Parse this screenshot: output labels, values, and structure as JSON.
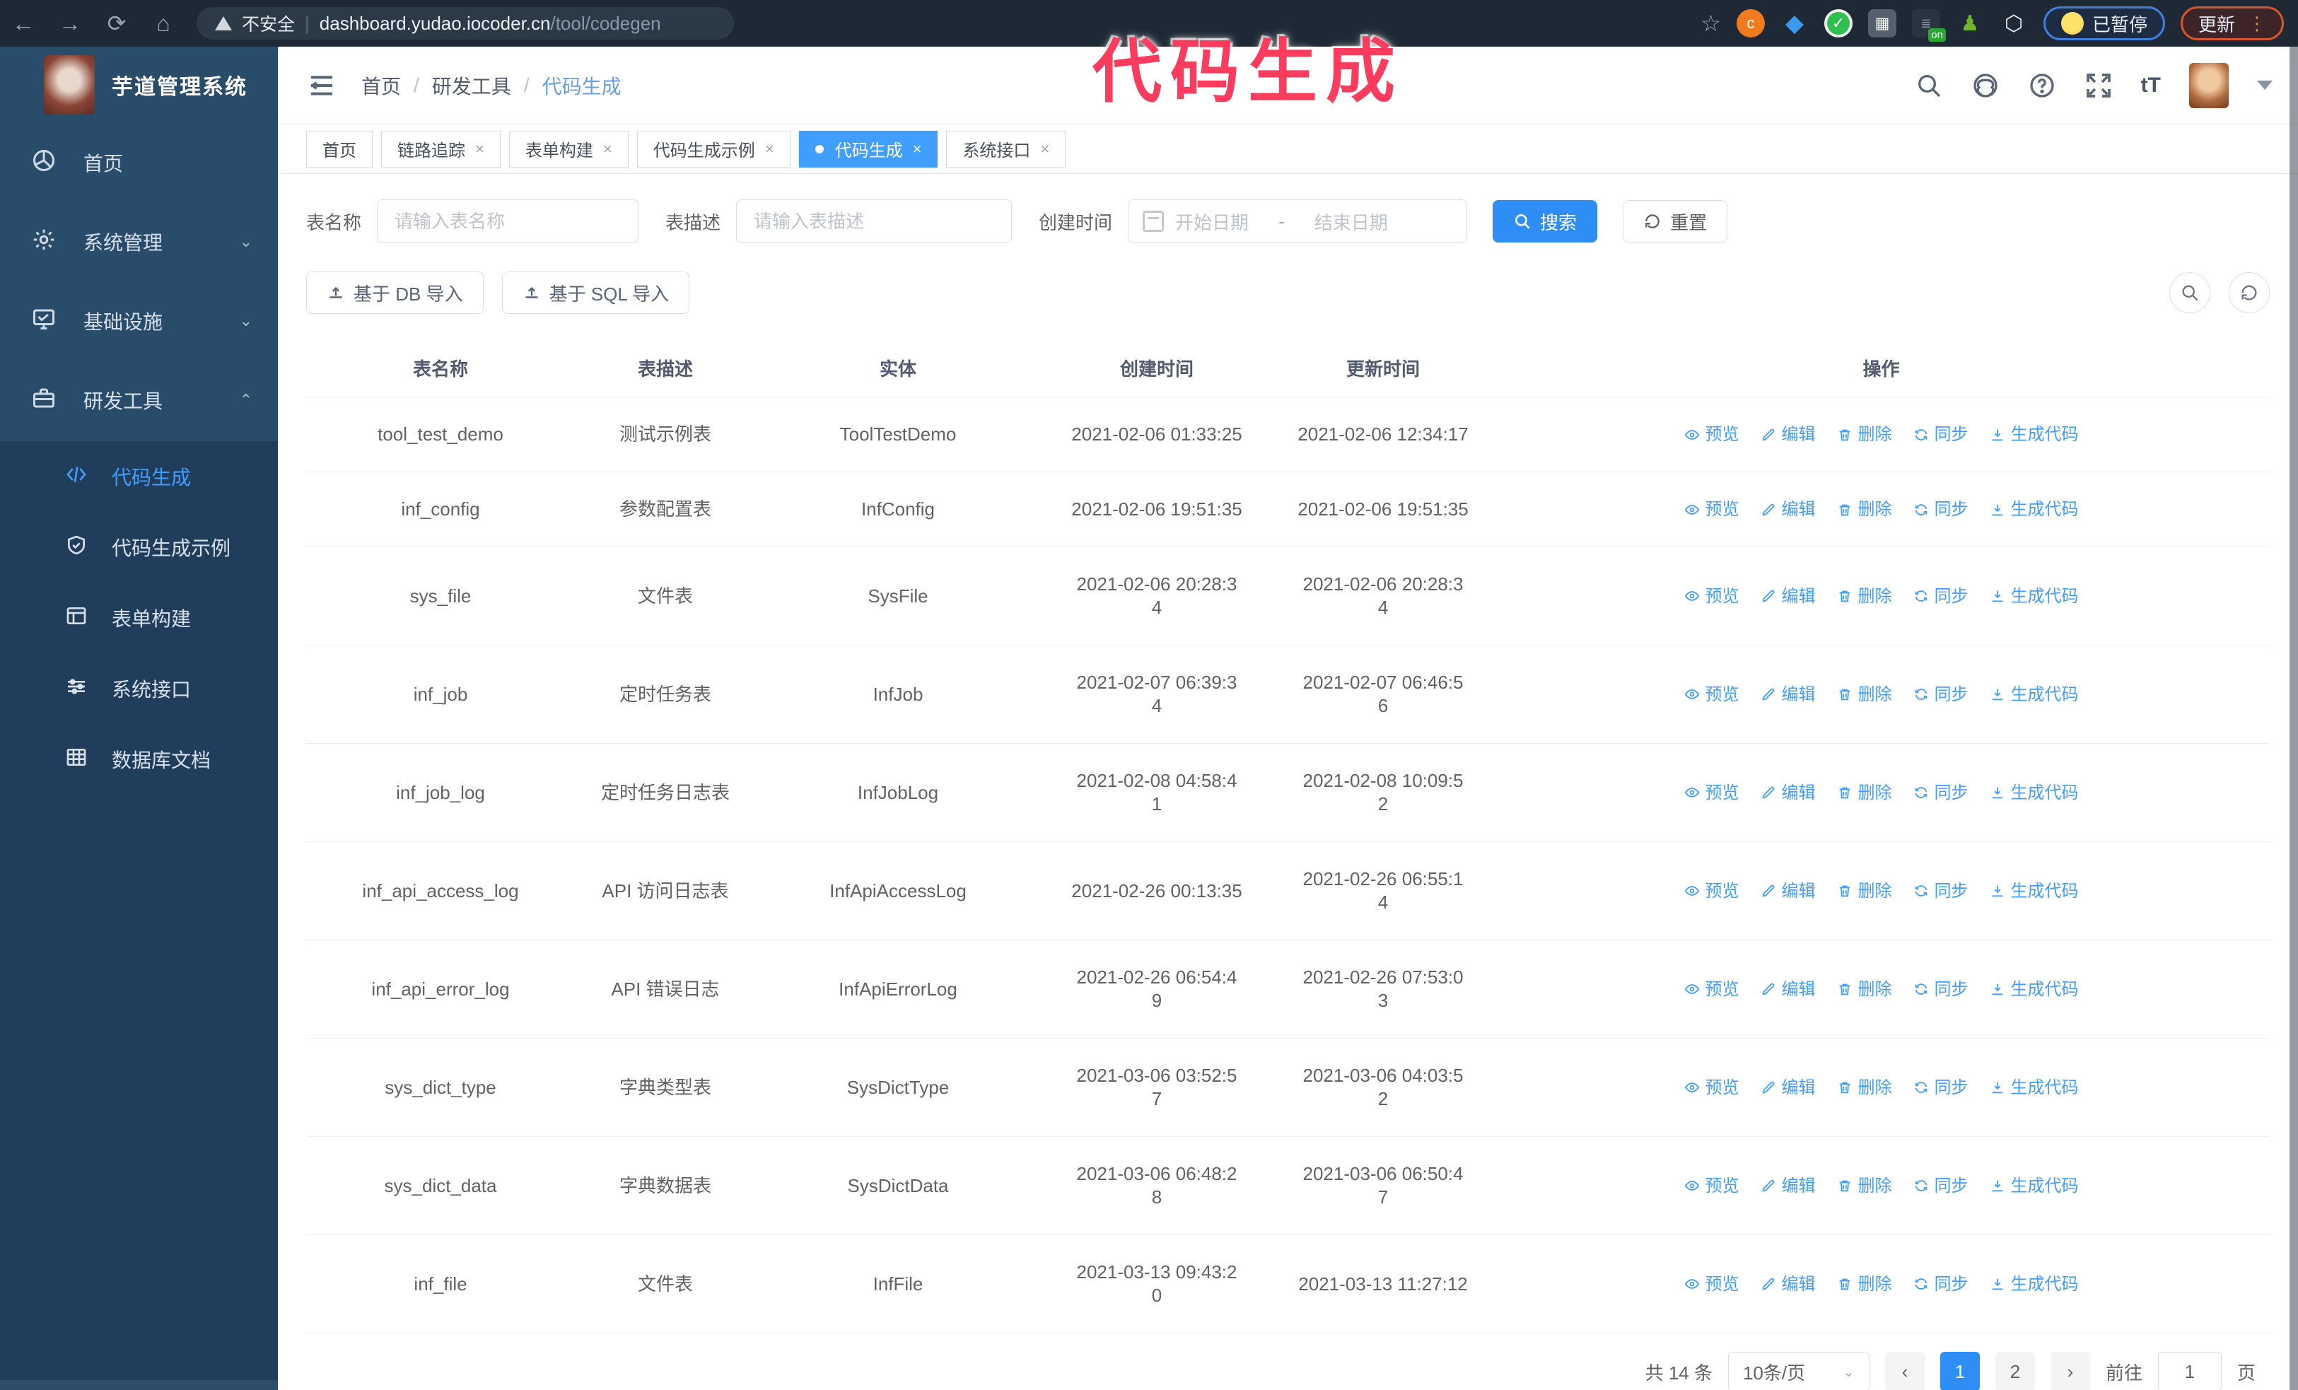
{
  "browser": {
    "security_label": "不安全",
    "url_domain": "dashboard.yudao.iocoder.cn",
    "url_path": "/tool/codegen",
    "paused_badge": "已暂停",
    "update_button": "更新"
  },
  "overlay_title": "代码生成",
  "sidebar": {
    "app_title": "芋道管理系统",
    "items": [
      {
        "label": "首页"
      },
      {
        "label": "系统管理"
      },
      {
        "label": "基础设施"
      },
      {
        "label": "研发工具"
      }
    ],
    "submenu": [
      {
        "label": "代码生成"
      },
      {
        "label": "代码生成示例"
      },
      {
        "label": "表单构建"
      },
      {
        "label": "系统接口"
      },
      {
        "label": "数据库文档"
      }
    ]
  },
  "header": {
    "breadcrumb": [
      "首页",
      "研发工具",
      "代码生成"
    ]
  },
  "tabs": [
    {
      "label": "首页"
    },
    {
      "label": "链路追踪"
    },
    {
      "label": "表单构建"
    },
    {
      "label": "代码生成示例"
    },
    {
      "label": "代码生成"
    },
    {
      "label": "系统接口"
    }
  ],
  "filters": {
    "table_name_label": "表名称",
    "table_name_placeholder": "请输入表名称",
    "table_desc_label": "表描述",
    "table_desc_placeholder": "请输入表描述",
    "create_time_label": "创建时间",
    "date_start_placeholder": "开始日期",
    "date_separator": "-",
    "date_end_placeholder": "结束日期",
    "search_label": "搜索",
    "reset_label": "重置"
  },
  "toolbar": {
    "import_db_label": "基于 DB 导入",
    "import_sql_label": "基于 SQL 导入"
  },
  "table": {
    "columns": [
      "表名称",
      "表描述",
      "实体",
      "创建时间",
      "更新时间",
      "操作"
    ],
    "actions": [
      "预览",
      "编辑",
      "删除",
      "同步",
      "生成代码"
    ],
    "rows": [
      {
        "name": "tool_test_demo",
        "desc": "测试示例表",
        "entity": "ToolTestDemo",
        "create": "2021-02-06 01:33:25",
        "update": "2021-02-06 12:34:17"
      },
      {
        "name": "inf_config",
        "desc": "参数配置表",
        "entity": "InfConfig",
        "create": "2021-02-06 19:51:35",
        "update": "2021-02-06 19:51:35"
      },
      {
        "name": "sys_file",
        "desc": "文件表",
        "entity": "SysFile",
        "create": "2021-02-06 20:28:3\n4",
        "update": "2021-02-06 20:28:3\n4"
      },
      {
        "name": "inf_job",
        "desc": "定时任务表",
        "entity": "InfJob",
        "create": "2021-02-07 06:39:3\n4",
        "update": "2021-02-07 06:46:5\n6"
      },
      {
        "name": "inf_job_log",
        "desc": "定时任务日志表",
        "entity": "InfJobLog",
        "create": "2021-02-08 04:58:4\n1",
        "update": "2021-02-08 10:09:5\n2"
      },
      {
        "name": "inf_api_access_log",
        "desc": "API 访问日志表",
        "entity": "InfApiAccessLog",
        "create": "2021-02-26 00:13:35",
        "update": "2021-02-26 06:55:1\n4"
      },
      {
        "name": "inf_api_error_log",
        "desc": "API 错误日志",
        "entity": "InfApiErrorLog",
        "create": "2021-02-26 06:54:4\n9",
        "update": "2021-02-26 07:53:0\n3"
      },
      {
        "name": "sys_dict_type",
        "desc": "字典类型表",
        "entity": "SysDictType",
        "create": "2021-03-06 03:52:5\n7",
        "update": "2021-03-06 04:03:5\n2"
      },
      {
        "name": "sys_dict_data",
        "desc": "字典数据表",
        "entity": "SysDictData",
        "create": "2021-03-06 06:48:2\n8",
        "update": "2021-03-06 06:50:4\n7"
      },
      {
        "name": "inf_file",
        "desc": "文件表",
        "entity": "InfFile",
        "create": "2021-03-13 09:43:2\n0",
        "update": "2021-03-13 11:27:12"
      }
    ]
  },
  "pagination": {
    "total": "共 14 条",
    "page_size": "10条/页",
    "page_1": "1",
    "page_2": "2",
    "goto_label": "前往",
    "goto_value": "1",
    "page_suffix": "页"
  }
}
